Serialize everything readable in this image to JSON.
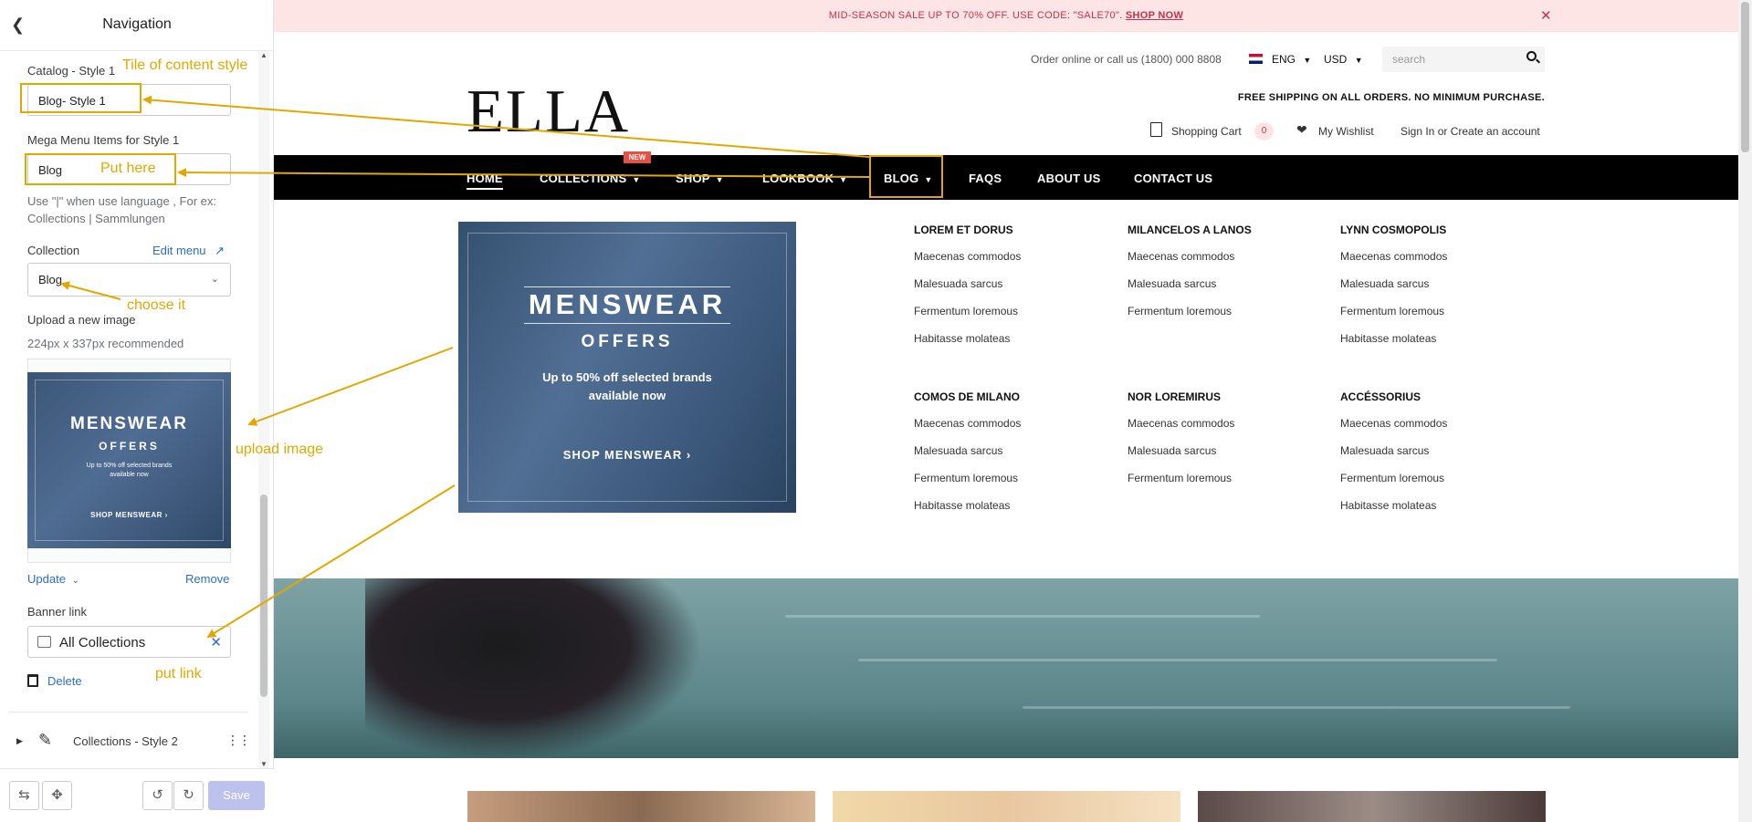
{
  "editor": {
    "title": "Navigation",
    "back_icon": "chevron-left-icon",
    "catalog_label": "Catalog - Style 1",
    "catalog_value": "Blog- Style 1",
    "mega_label": "Mega Menu Items for Style 1",
    "mega_value": "Blog",
    "help_line1": "Use \"|\" when use language , For ex:",
    "help_line2": "Collections | Sammlungen",
    "collection_label": "Collection",
    "edit_menu": "Edit menu",
    "collection_value": "Blog",
    "upload_label": "Upload a new image",
    "upload_hint": "224px x 337px recommended",
    "thumb": {
      "line1": "MENSWEAR",
      "line2": "OFFERS",
      "line3": "Up to 50% off selected brands",
      "line4": "available now",
      "line5": "SHOP MENSWEAR ›"
    },
    "update": "Update",
    "remove": "Remove",
    "banner_label": "Banner link",
    "banner_value": "All Collections",
    "delete": "Delete",
    "collections_style2": "Collections - Style 2",
    "save": "Save"
  },
  "annotations": {
    "tile": "Tile of content style",
    "put_here": "Put here",
    "choose_it": "choose it",
    "upload_image": "upload image",
    "put_link": "put link"
  },
  "store": {
    "promo_text": "MID-SEASON SALE UP TO 70% OFF. USE CODE: \"SALE70\".",
    "promo_link": "SHOP NOW",
    "phone": "Order online or call us (1800) 000 8808",
    "lang": "ENG",
    "currency": "USD",
    "search_placeholder": "search",
    "logo": "ELLA",
    "free_shipping": "FREE SHIPPING ON ALL ORDERS. NO MINIMUM PURCHASE.",
    "cart": "Shopping Cart",
    "cart_count": "0",
    "wishlist": "My Wishlist",
    "signin": "Sign In or Create an account",
    "nav": {
      "home": "HOME",
      "collections": "COLLECTIONS",
      "new_badge": "NEW",
      "shop": "SHOP",
      "lookbook": "LOOKBOOK",
      "blog": "BLOG",
      "faqs": "FAQS",
      "about": "ABOUT US",
      "contact": "CONTACT US"
    },
    "banner": {
      "title": "MENSWEAR",
      "subtitle": "OFFERS",
      "line1": "Up to 50% off selected brands",
      "line2": "available now",
      "cta": "SHOP MENSWEAR ›"
    },
    "columns": [
      {
        "heading": "LOREM ET DORUS",
        "items": [
          "Maecenas commodos",
          "Malesuada sarcus",
          "Fermentum loremous",
          "Habitasse molateas"
        ]
      },
      {
        "heading": "MILANCELOS A LANOS",
        "items": [
          "Maecenas commodos",
          "Malesuada sarcus",
          "Fermentum loremous"
        ]
      },
      {
        "heading": "LYNN COSMOPOLIS",
        "items": [
          "Maecenas commodos",
          "Malesuada sarcus",
          "Fermentum loremous",
          "Habitasse molateas"
        ]
      },
      {
        "heading": "COMOS DE MILANO",
        "items": [
          "Maecenas commodos",
          "Malesuada sarcus",
          "Fermentum loremous",
          "Habitasse molateas"
        ]
      },
      {
        "heading": "NOR LOREMIRUS",
        "items": [
          "Maecenas commodos",
          "Malesuada sarcus",
          "Fermentum loremous"
        ]
      },
      {
        "heading": "ACCÉSSORIUS",
        "items": [
          "Maecenas commodos",
          "Malesuada sarcus",
          "Fermentum loremous",
          "Habitasse molateas"
        ]
      }
    ]
  },
  "colors": {
    "annotation": "#e0a800",
    "link": "#2c6ecb",
    "promo_bg": "#fde5e6",
    "promo_text": "#c2334a",
    "nav_bg": "#000000",
    "save_disabled": "#bcc2ec"
  }
}
